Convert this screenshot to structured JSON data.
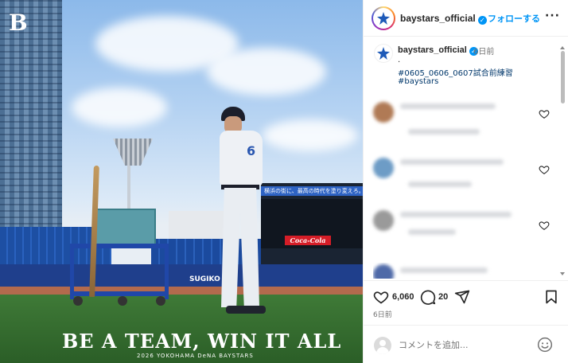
{
  "photo": {
    "corner_logo": "B",
    "scoreboard_banner": "横浜の街に、最高の時代を塗り変えろ。",
    "billboard": "Coca-Cola",
    "fence_sign": "SUGIKO",
    "jersey_number": "6",
    "slogan": "BE A TEAM, WIN IT ALL",
    "slogan_sub": "2026 YOKOHAMA DeNA BAYSTARS"
  },
  "header": {
    "username": "baystars_official",
    "follow_label": "フォローする",
    "more_icon": "more-horizontal-icon"
  },
  "caption": {
    "username": "baystars_official",
    "time": "6日前",
    "dot": ".",
    "tags": [
      "#0605_0606_0607試合前練習",
      "#baystars"
    ]
  },
  "comments": [
    {
      "avatar_color": "#b07a55"
    },
    {
      "avatar_color": "#6d9cc6"
    },
    {
      "avatar_color": "#9a9a9a"
    },
    {
      "avatar_color": "#4f6aa8"
    }
  ],
  "actions": {
    "like_count": "6,060",
    "comment_count": "20",
    "date": "6日前"
  },
  "comment_bar": {
    "placeholder": "コメントを追加..."
  },
  "colors": {
    "link_blue": "#0095f6",
    "hashtag": "#00376b",
    "brand_blue": "#1e5ab8"
  }
}
